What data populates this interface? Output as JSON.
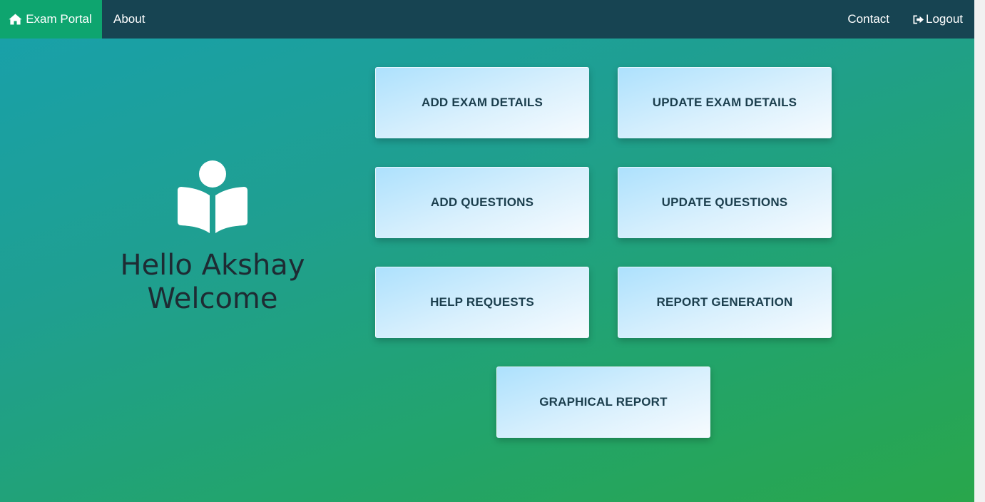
{
  "navbar": {
    "brand_label": "Exam Portal",
    "brand_icon": "home-icon",
    "about_label": "About",
    "contact_label": "Contact",
    "logout_label": "Logout",
    "logout_icon": "sign-out-icon",
    "colors": {
      "bar": "#174452",
      "brand_bg": "#0ea56f",
      "text": "#ffffff"
    }
  },
  "welcome": {
    "icon": "reader-book-icon",
    "line1": "Hello Akshay",
    "line2": "Welcome"
  },
  "tiles": {
    "add_exam_details": "ADD EXAM DETAILS",
    "update_exam_details": "UPDATE EXAM DETAILS",
    "add_questions": "ADD QUESTIONS",
    "update_questions": "UPDATE QUESTIONS",
    "help_requests": "HELP REQUESTS",
    "report_generation": "REPORT GENERATION",
    "graphical_report": "GRAPHICAL REPORT"
  },
  "colors": {
    "background_start": "#18a1ac",
    "background_end": "#29a64b",
    "tile_text": "#1b3e4d",
    "greeting_text": "#1e2b33"
  }
}
